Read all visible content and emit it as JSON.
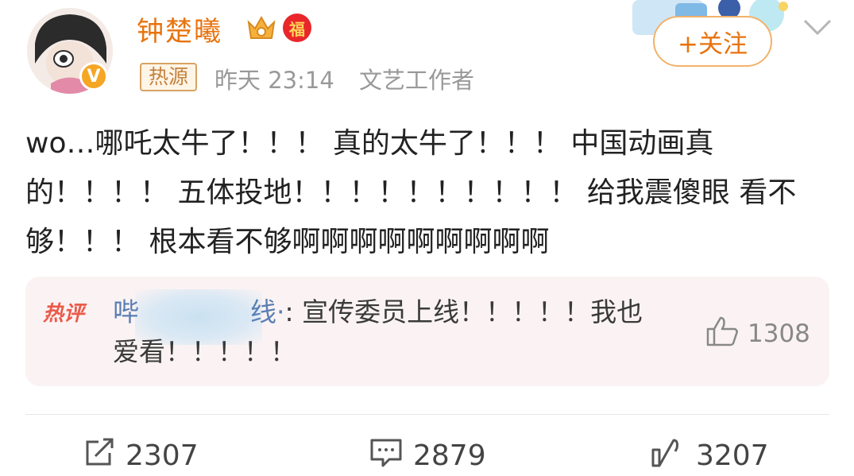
{
  "post": {
    "username": "钟楚曦",
    "hot_tag": "热源",
    "time": "昨天 23:14",
    "identity": "文艺工作者",
    "follow_label": "+关注",
    "fu_badge": "福",
    "verified_badge": "V",
    "text": "wo…哪吒太牛了！！！ 真的太牛了！！！  中国动画真的！！！！ 五体投地！！！！！！！！！！ 给我震傻眼 看不够！！！ 根本看不够啊啊啊啊啊啊啊啊啊"
  },
  "hot_comment": {
    "label": "热评",
    "user_start": "哔",
    "user_end": "线·",
    "text": ": 宣传委员上线！！！！！我也爱看！！！！！",
    "likes": "1308"
  },
  "actions": {
    "repost_count": "2307",
    "comment_count": "2879",
    "like_count": "3207"
  },
  "colors": {
    "accent": "#e8730e",
    "hot_red": "#ea5a4a",
    "link_blue": "#5a7fb5"
  },
  "icons": [
    "crown-icon",
    "repost-icon",
    "comment-icon",
    "like-icon",
    "thumb-up-icon",
    "chevron-down-icon"
  ]
}
